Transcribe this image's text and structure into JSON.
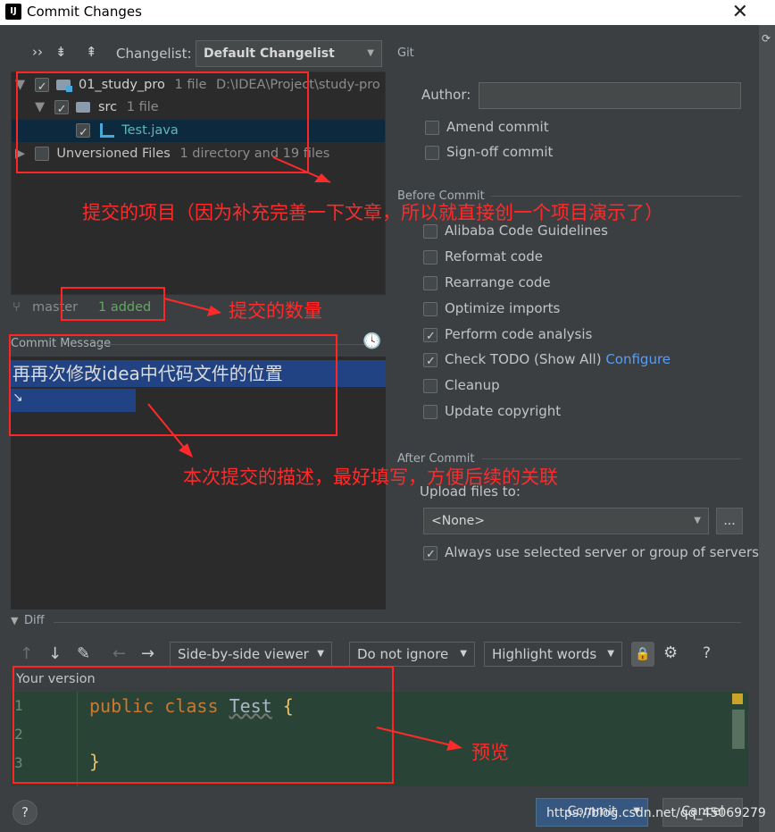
{
  "window": {
    "title": "Commit Changes",
    "logo_text": "IJ",
    "close_glyph": "✕",
    "side_icon": "⟳"
  },
  "toolbar": {
    "expand_glyph": "››",
    "collapse_glyph": "⇟",
    "diff_glyph": "⇞",
    "changelist_label": "Changelist:",
    "changelist_value": "Default Changelist"
  },
  "tree": {
    "project": {
      "name": "01_study_pro",
      "count": "1 file",
      "path": "D:\\IDEA\\Project\\study-pro"
    },
    "src": {
      "name": "src",
      "count": "1 file"
    },
    "file": {
      "name": "Test.java"
    },
    "unversioned": {
      "name": "Unversioned Files",
      "count": "1 directory and 19 files"
    }
  },
  "status": {
    "branch": "master",
    "added": "1 added"
  },
  "commit_message": {
    "label": "Commit Message",
    "line1": "再再次修改idea中代码文件的位置",
    "line2_prefix": "↘"
  },
  "git": {
    "section": "Git",
    "author_label": "Author:",
    "author_value": "",
    "amend": "Amend commit",
    "signoff": "Sign-off commit"
  },
  "before_commit": {
    "section": "Before Commit",
    "options": [
      {
        "label": "Alibaba Code Guidelines",
        "checked": false
      },
      {
        "label": "Reformat code",
        "checked": false
      },
      {
        "label": "Rearrange code",
        "checked": false
      },
      {
        "label": "Optimize imports",
        "checked": false
      },
      {
        "label": "Perform code analysis",
        "checked": true
      },
      {
        "label": "Check TODO (Show All)",
        "checked": true,
        "link": "Configure"
      },
      {
        "label": "Cleanup",
        "checked": false
      },
      {
        "label": "Update copyright",
        "checked": false
      }
    ]
  },
  "after_commit": {
    "section": "After Commit",
    "upload_label": "Upload files to:",
    "upload_value": "<None>",
    "browse": "...",
    "always_use": "Always use selected server or group of servers"
  },
  "diff": {
    "section": "Diff",
    "viewer": "Side-by-side viewer",
    "whitespace": "Do not ignore",
    "highlight": "Highlight words",
    "help": "?",
    "your_version": "Your version",
    "lines": [
      "1",
      "2",
      "3"
    ],
    "code_kw1": "public",
    "code_kw2": "class",
    "code_cls": "Test",
    "code_open": "{",
    "code_close": "}"
  },
  "footer": {
    "help": "?",
    "commit": "Commit",
    "cancel": "Cancel",
    "watermark": "https://blog.csdn.net/qq_45069279"
  },
  "annotations": {
    "project": "提交的项目（因为补充完善一下文章，所以就直接创一个项目演示了）",
    "count": "提交的数量",
    "description": "本次提交的描述，最好填写，方便后续的关联",
    "preview": "预览"
  },
  "colors": {
    "annotation": "#ff2a2a",
    "background": "#3c3f41",
    "link": "#589df6"
  }
}
